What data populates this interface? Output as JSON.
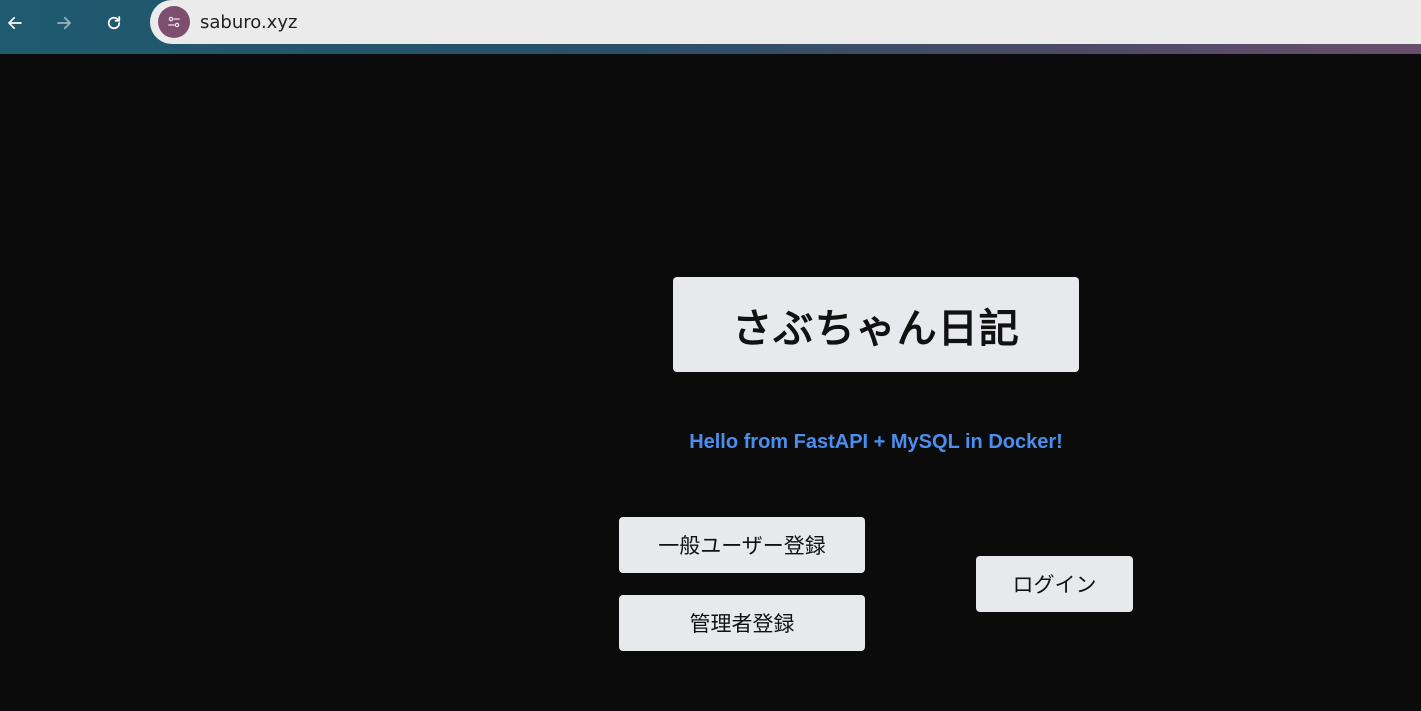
{
  "browser": {
    "url": "saburo.xyz",
    "icons": {
      "back": "arrow-left-icon",
      "forward": "arrow-right-icon",
      "reload": "reload-icon",
      "site": "site-settings-icon"
    }
  },
  "page": {
    "title": "さぶちゃん日記",
    "message": "Hello from FastAPI + MySQL in Docker!",
    "buttons": {
      "general_register": "一般ユーザー登録",
      "admin_register": "管理者登録",
      "login": "ログイン"
    }
  },
  "colors": {
    "background": "#0b0b0b",
    "card": "#e8e9ed",
    "accent_text": "#4a8ff0"
  }
}
